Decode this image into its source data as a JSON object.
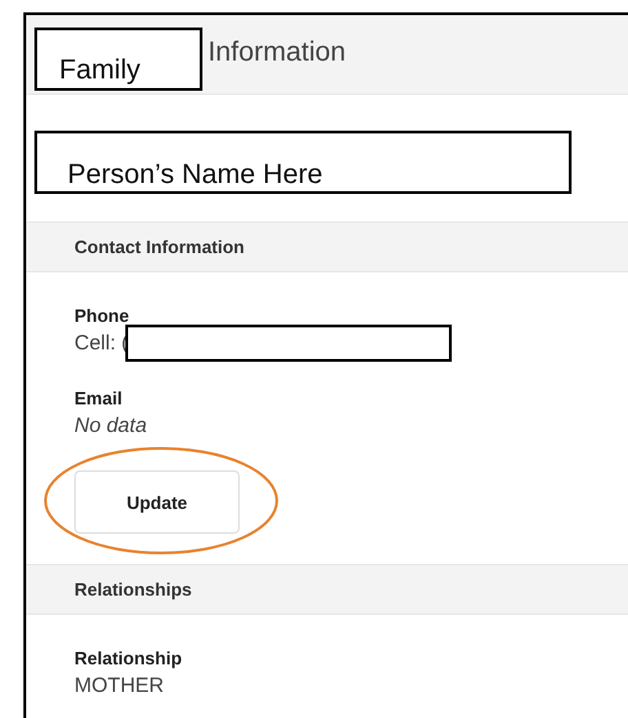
{
  "header": {
    "title_word": "Family",
    "title_rest": "Information"
  },
  "name": "Person’s Name Here",
  "sections": [
    {
      "title": "Contact Information",
      "fields": [
        {
          "label": "Phone",
          "value": "Cell: (",
          "redacted": true
        },
        {
          "label": "Email",
          "value": "No data",
          "empty": true
        }
      ],
      "button": {
        "label": "Update",
        "circled": true
      }
    },
    {
      "title": "Relationships",
      "fields": [
        {
          "label": "Relationship",
          "value": "MOTHER"
        }
      ]
    }
  ]
}
